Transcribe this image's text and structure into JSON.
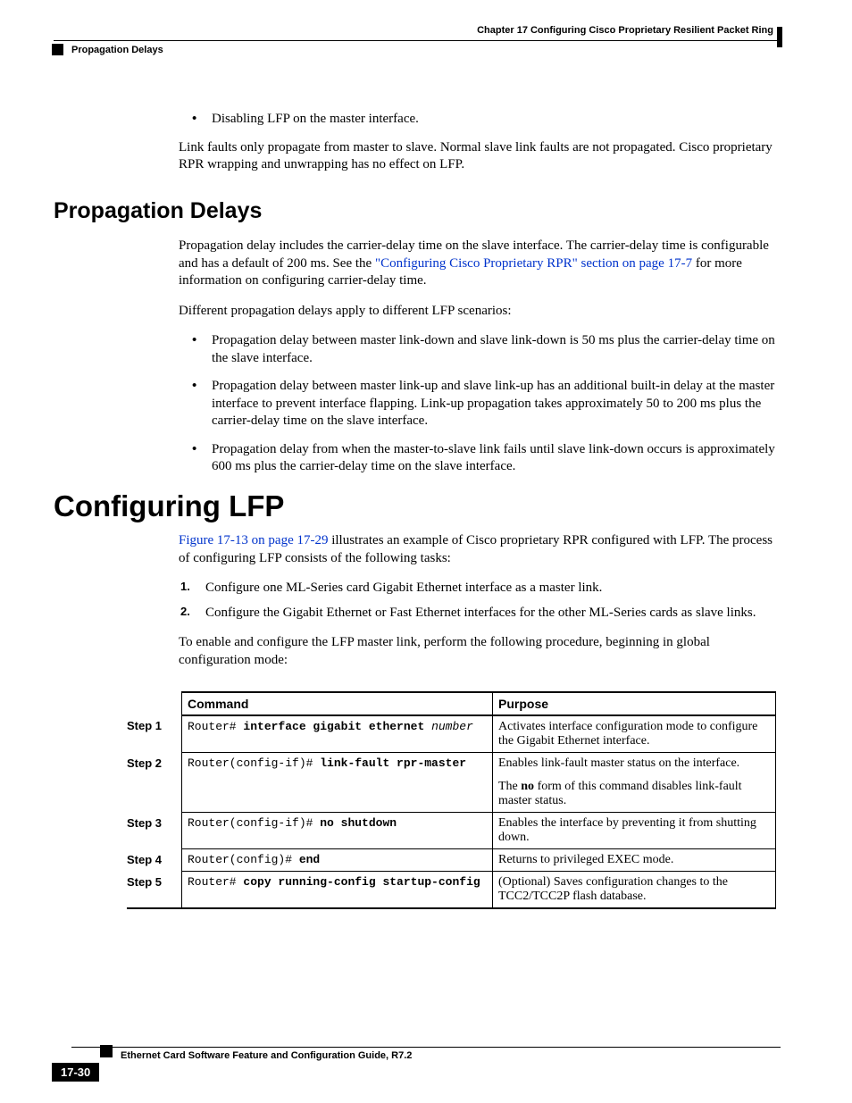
{
  "header": {
    "chapter": "Chapter 17    Configuring Cisco Proprietary Resilient Packet Ring",
    "section": "Propagation Delays"
  },
  "intro": {
    "bullet1": "Disabling LFP on the master interface.",
    "para1": "Link faults only propagate from master to slave. Normal slave link faults are not propagated. Cisco proprietary RPR wrapping and unwrapping has no effect on LFP."
  },
  "propagation": {
    "heading": "Propagation Delays",
    "para1a": "Propagation delay includes the carrier-delay time on the slave interface. The carrier-delay time is configurable and has a default of 200 ms. See the ",
    "link1": "\"Configuring Cisco Proprietary RPR\" section on page 17-7",
    "para1b": " for more information on configuring carrier-delay time.",
    "para2": "Different propagation delays apply to different LFP scenarios:",
    "b1": "Propagation delay between master link-down and slave link-down is 50 ms plus the carrier-delay time on the slave interface.",
    "b2": "Propagation delay between master link-up and slave link-up has an additional built-in delay at the master interface to prevent interface flapping. Link-up propagation takes approximately 50 to 200 ms plus the carrier-delay time on the slave interface.",
    "b3": "Propagation delay from when the master-to-slave link fails until slave link-down occurs is approximately 600 ms plus the carrier-delay time on the slave interface."
  },
  "configuring": {
    "heading": "Configuring LFP",
    "link1": "Figure 17-13 on page 17-29",
    "para1b": " illustrates an example of Cisco proprietary RPR configured with LFP. The process of configuring LFP consists of the following tasks:",
    "n1": "Configure one ML-Series card Gigabit Ethernet interface as a master link.",
    "n2": "Configure the Gigabit Ethernet or Fast Ethernet interfaces for the other ML-Series cards as slave links.",
    "para2": "To enable and configure the LFP master link, perform the following procedure, beginning in global configuration mode:"
  },
  "table": {
    "col1": "Command",
    "col2": "Purpose",
    "rows": [
      {
        "step": "Step 1",
        "cmd_prefix": "Router# ",
        "cmd_bold": "interface gigabit ethernet",
        "cmd_suffix_italic": " number",
        "purpose": "Activates interface configuration mode to configure the Gigabit Ethernet interface."
      },
      {
        "step": "Step 2",
        "cmd_prefix": "Router(config-if)# ",
        "cmd_bold": "link-fault rpr-master",
        "cmd_suffix_italic": "",
        "purpose_line1": "Enables link-fault master status on the interface.",
        "purpose_line2a": "The ",
        "purpose_line2_bold": "no",
        "purpose_line2b": " form of this command disables link-fault master status."
      },
      {
        "step": "Step 3",
        "cmd_prefix": "Router(config-if)# ",
        "cmd_bold": "no shutdown",
        "cmd_suffix_italic": "",
        "purpose": "Enables the interface by preventing it from shutting down."
      },
      {
        "step": "Step 4",
        "cmd_prefix": "Router(config)# ",
        "cmd_bold": "end",
        "cmd_suffix_italic": "",
        "purpose": "Returns to privileged EXEC mode."
      },
      {
        "step": "Step 5",
        "cmd_prefix": "Router# ",
        "cmd_bold": "copy running-config startup-config",
        "cmd_suffix_italic": "",
        "purpose": "(Optional) Saves configuration changes to the TCC2/TCC2P flash database."
      }
    ]
  },
  "footer": {
    "title": "Ethernet Card Software Feature and Configuration Guide, R7.2",
    "page": "17-30"
  }
}
